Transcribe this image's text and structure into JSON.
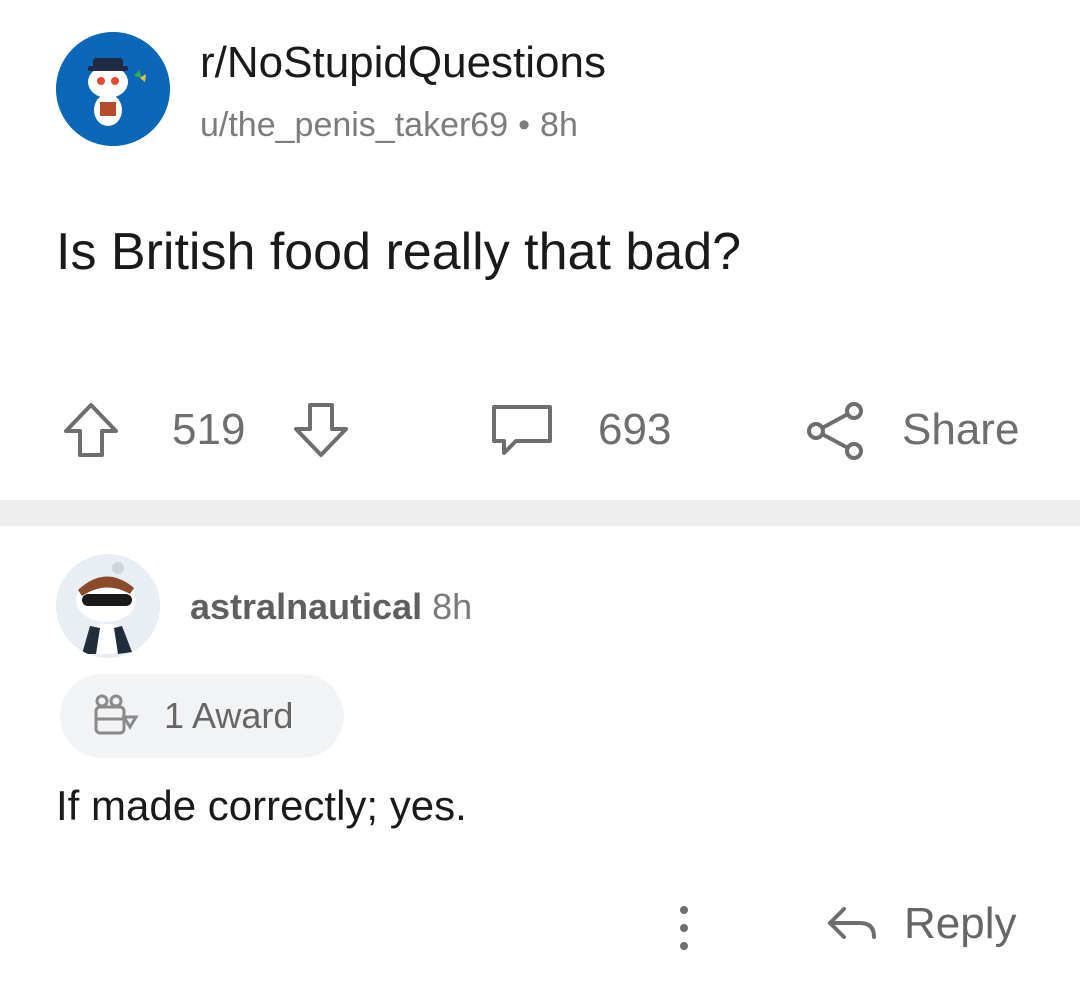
{
  "post": {
    "subreddit": "r/NoStupidQuestions",
    "author": "u/the_penis_taker69",
    "separator": "•",
    "age": "8h",
    "title": "Is British food really that bad?",
    "icons": {
      "avatar": "subreddit-avatar",
      "upvote": "arrow-up-icon",
      "downvote": "arrow-down-icon",
      "comments": "comment-bubble-icon",
      "share": "share-icon"
    },
    "votes": "519",
    "comments": "693",
    "share_label": "Share"
  },
  "comment": {
    "author": "astralnautical",
    "age": "8h",
    "award_label": "1 Award",
    "body": "If made correctly; yes.",
    "more_icon": "more-vertical-icon",
    "reply_icon": "reply-arrow-icon",
    "reply_label": "Reply"
  },
  "colors": {
    "text": "#1a1a1b",
    "muted": "#7c7c7c",
    "action": "#6e6e6e",
    "subreddit_avatar_bg": "#0b67b7",
    "divider": "#eeeeee",
    "award_pill_bg": "#f2f3f5"
  }
}
